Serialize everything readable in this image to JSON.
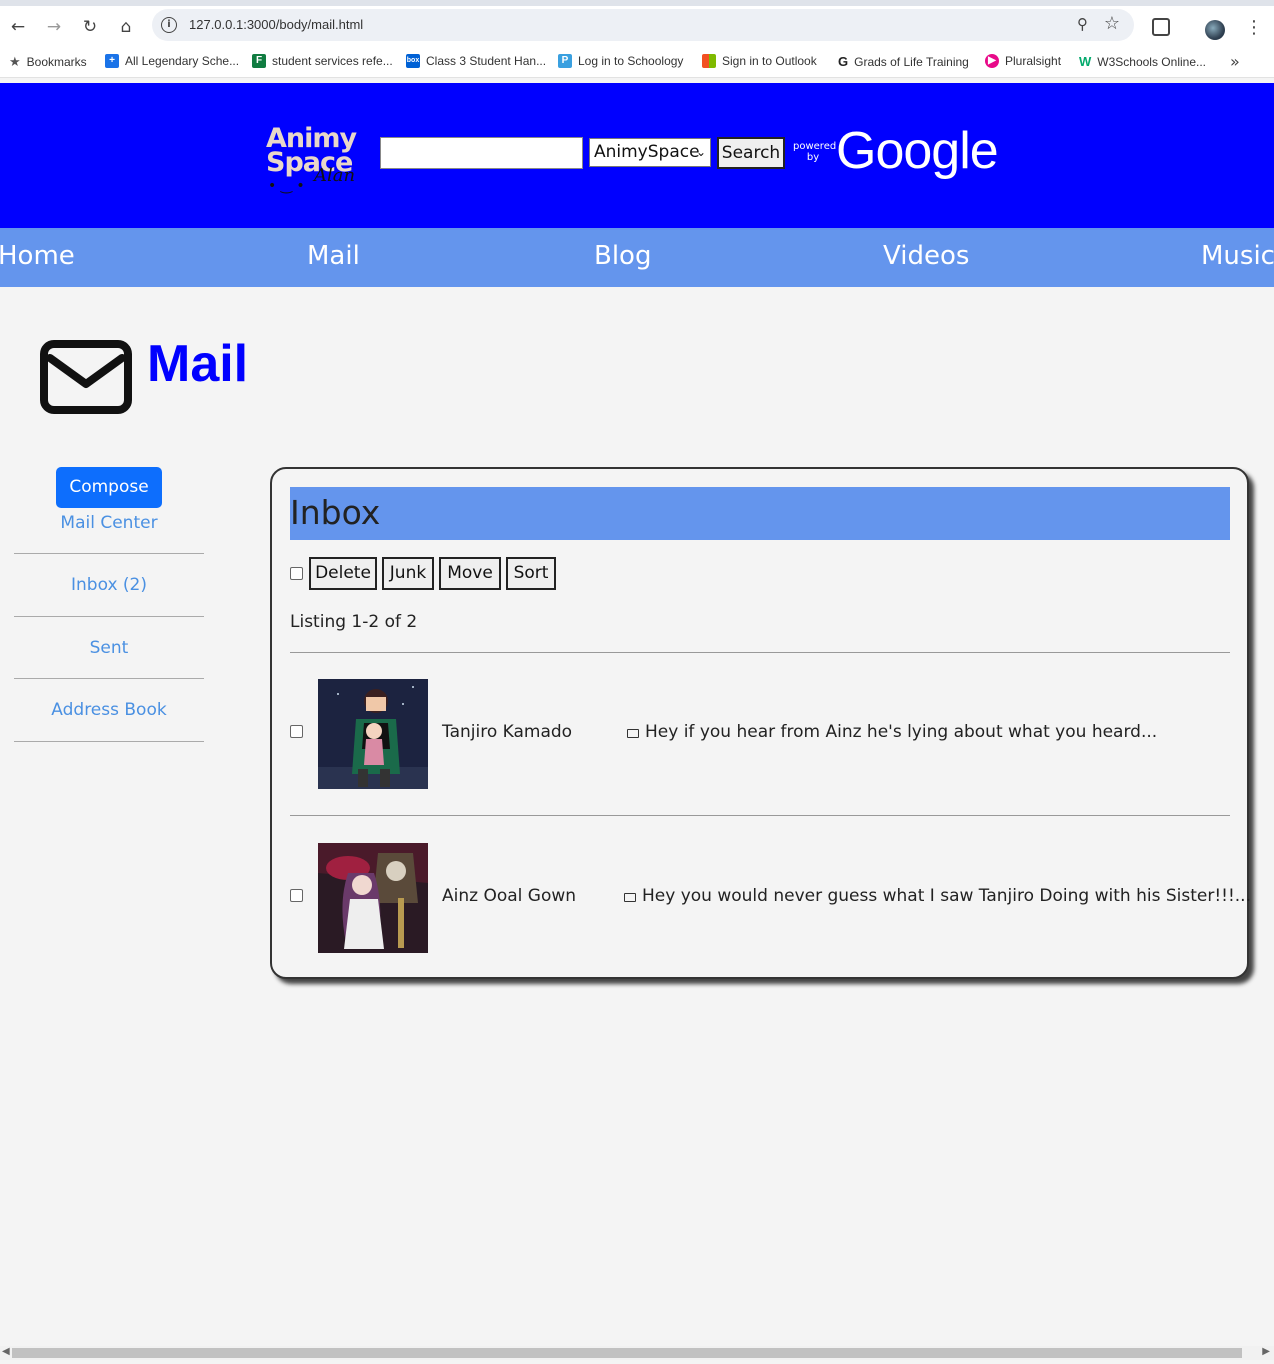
{
  "browser": {
    "url": "127.0.0.1:3000/body/mail.html",
    "bookmarks": [
      {
        "label": "Bookmarks",
        "icon": "star-icon",
        "color": "#555555"
      },
      {
        "label": "All Legendary Sche...",
        "icon": "plus-box-icon",
        "color": "#1a73e8"
      },
      {
        "label": "student services refe...",
        "icon": "forms-icon",
        "color": "#107c41"
      },
      {
        "label": "Class 3 Student Han...",
        "icon": "box-icon",
        "color": "#0061d5"
      },
      {
        "label": "Log in to Schoology",
        "icon": "schoology-icon",
        "color": "#3aa0e0"
      },
      {
        "label": "Sign in to Outlook",
        "icon": "microsoft-icon",
        "color": "#f25022"
      },
      {
        "label": "Grads of Life Training",
        "icon": "g-icon",
        "color": "#222222"
      },
      {
        "label": "Pluralsight",
        "icon": "pluralsight-icon",
        "color": "#e80a89"
      },
      {
        "label": "W3Schools Online...",
        "icon": "w3schools-icon",
        "color": "#04aa6d"
      }
    ]
  },
  "header": {
    "logo_line1": "Animy",
    "logo_line2": "Space",
    "logo_signature": "Alan",
    "search_select_value": "AnimySpace",
    "search_button": "Search",
    "powered_by": "powered by",
    "google": "Google"
  },
  "nav": [
    "Home",
    "Mail",
    "Blog",
    "Videos",
    "Music"
  ],
  "page": {
    "title": "Mail"
  },
  "sidebar": {
    "compose": "Compose",
    "mail_center": "Mail Center",
    "links": [
      "Inbox (2)",
      "Sent",
      "Address Book"
    ]
  },
  "inbox": {
    "title": "Inbox",
    "actions": [
      "Delete",
      "Junk",
      "Move",
      "Sort"
    ],
    "listing": "Listing 1-2 of 2",
    "messages": [
      {
        "sender": "Tanjiro Kamado",
        "preview": "Hey if you hear from Ainz he's lying about what you heard..."
      },
      {
        "sender": "Ainz Ooal Gown",
        "preview": "Hey you would never guess what I saw Tanjiro Doing with his Sister!!!..."
      }
    ]
  },
  "colors": {
    "header_bg": "#0000ff",
    "nav_bg": "#6495ed",
    "compose_bg": "#0d6efd",
    "link": "#4a90e2"
  }
}
